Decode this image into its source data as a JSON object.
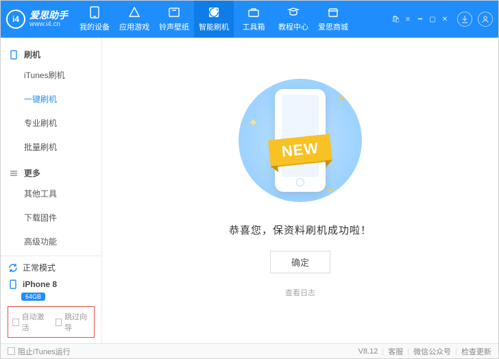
{
  "brand": {
    "name": "爱思助手",
    "site": "www.i4.cn",
    "logo_text": "i4"
  },
  "tabs": [
    {
      "label": "我的设备"
    },
    {
      "label": "应用游戏"
    },
    {
      "label": "铃声壁纸"
    },
    {
      "label": "智能刷机",
      "active": true
    },
    {
      "label": "工具箱"
    },
    {
      "label": "教程中心"
    },
    {
      "label": "爱思商城"
    }
  ],
  "sidebar": {
    "groups": [
      {
        "title": "刷机",
        "icon": "phone",
        "items": [
          {
            "label": "iTunes刷机"
          },
          {
            "label": "一键刷机",
            "active": true
          },
          {
            "label": "专业刷机"
          },
          {
            "label": "批量刷机"
          }
        ]
      },
      {
        "title": "更多",
        "icon": "more",
        "items": [
          {
            "label": "其他工具"
          },
          {
            "label": "下载固件"
          },
          {
            "label": "高级功能"
          }
        ]
      }
    ],
    "mode_label": "正常模式",
    "device_name": "iPhone 8",
    "device_storage": "64GB",
    "checkboxes": {
      "auto_activate": "自动激活",
      "skip_guide": "跳过向导"
    }
  },
  "content": {
    "ribbon_text": "NEW",
    "message": "恭喜您，保资料刷机成功啦！",
    "confirm_label": "确定",
    "log_link": "查看日志"
  },
  "footer": {
    "block_itunes": "阻止iTunes运行",
    "version": "V8.12",
    "links": {
      "service": "客服",
      "wechat": "微信公众号",
      "update": "检查更新"
    }
  }
}
